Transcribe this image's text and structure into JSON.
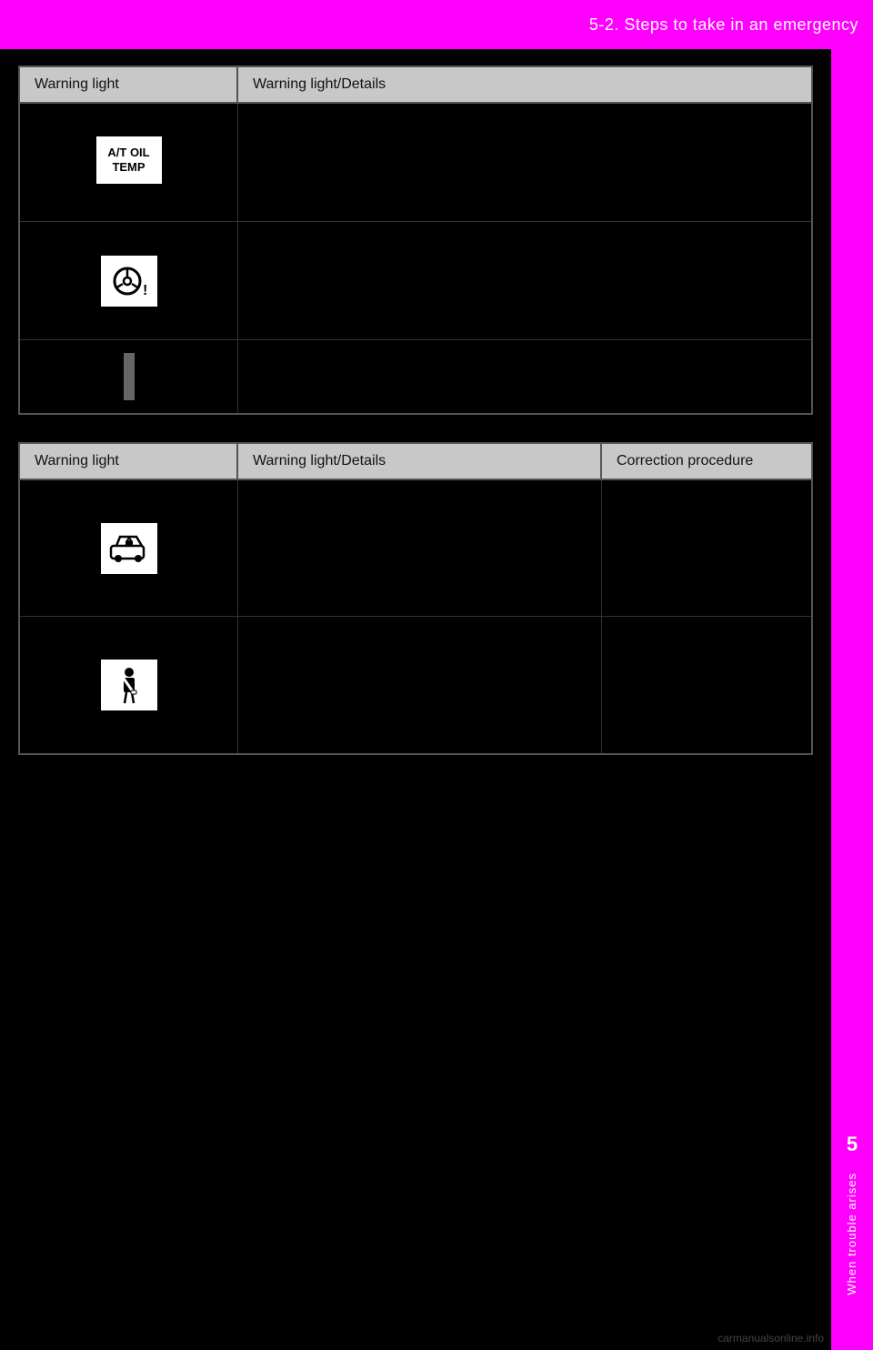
{
  "header": {
    "title": "5-2. Steps to take in an emergency",
    "background_color": "#ff00ff"
  },
  "sidebar": {
    "number": "5",
    "label": "When trouble arises"
  },
  "watermark": "carmanualsonline.info",
  "table1": {
    "headers": [
      "Warning light",
      "Warning light/Details"
    ],
    "rows": [
      {
        "icon_type": "at_oil_temp",
        "icon_text": "A/T OIL\nTEMP",
        "details": ""
      },
      {
        "icon_type": "steering",
        "icon_text": "",
        "details": ""
      },
      {
        "has_accent": true,
        "details": ""
      }
    ]
  },
  "table2": {
    "headers": [
      "Warning light",
      "Warning light/Details",
      "Correction procedure"
    ],
    "rows": [
      {
        "icon_type": "car_security",
        "icon_text": "",
        "details": "",
        "correction": ""
      },
      {
        "icon_type": "seatbelt",
        "icon_text": "",
        "details": "",
        "correction": ""
      }
    ]
  }
}
